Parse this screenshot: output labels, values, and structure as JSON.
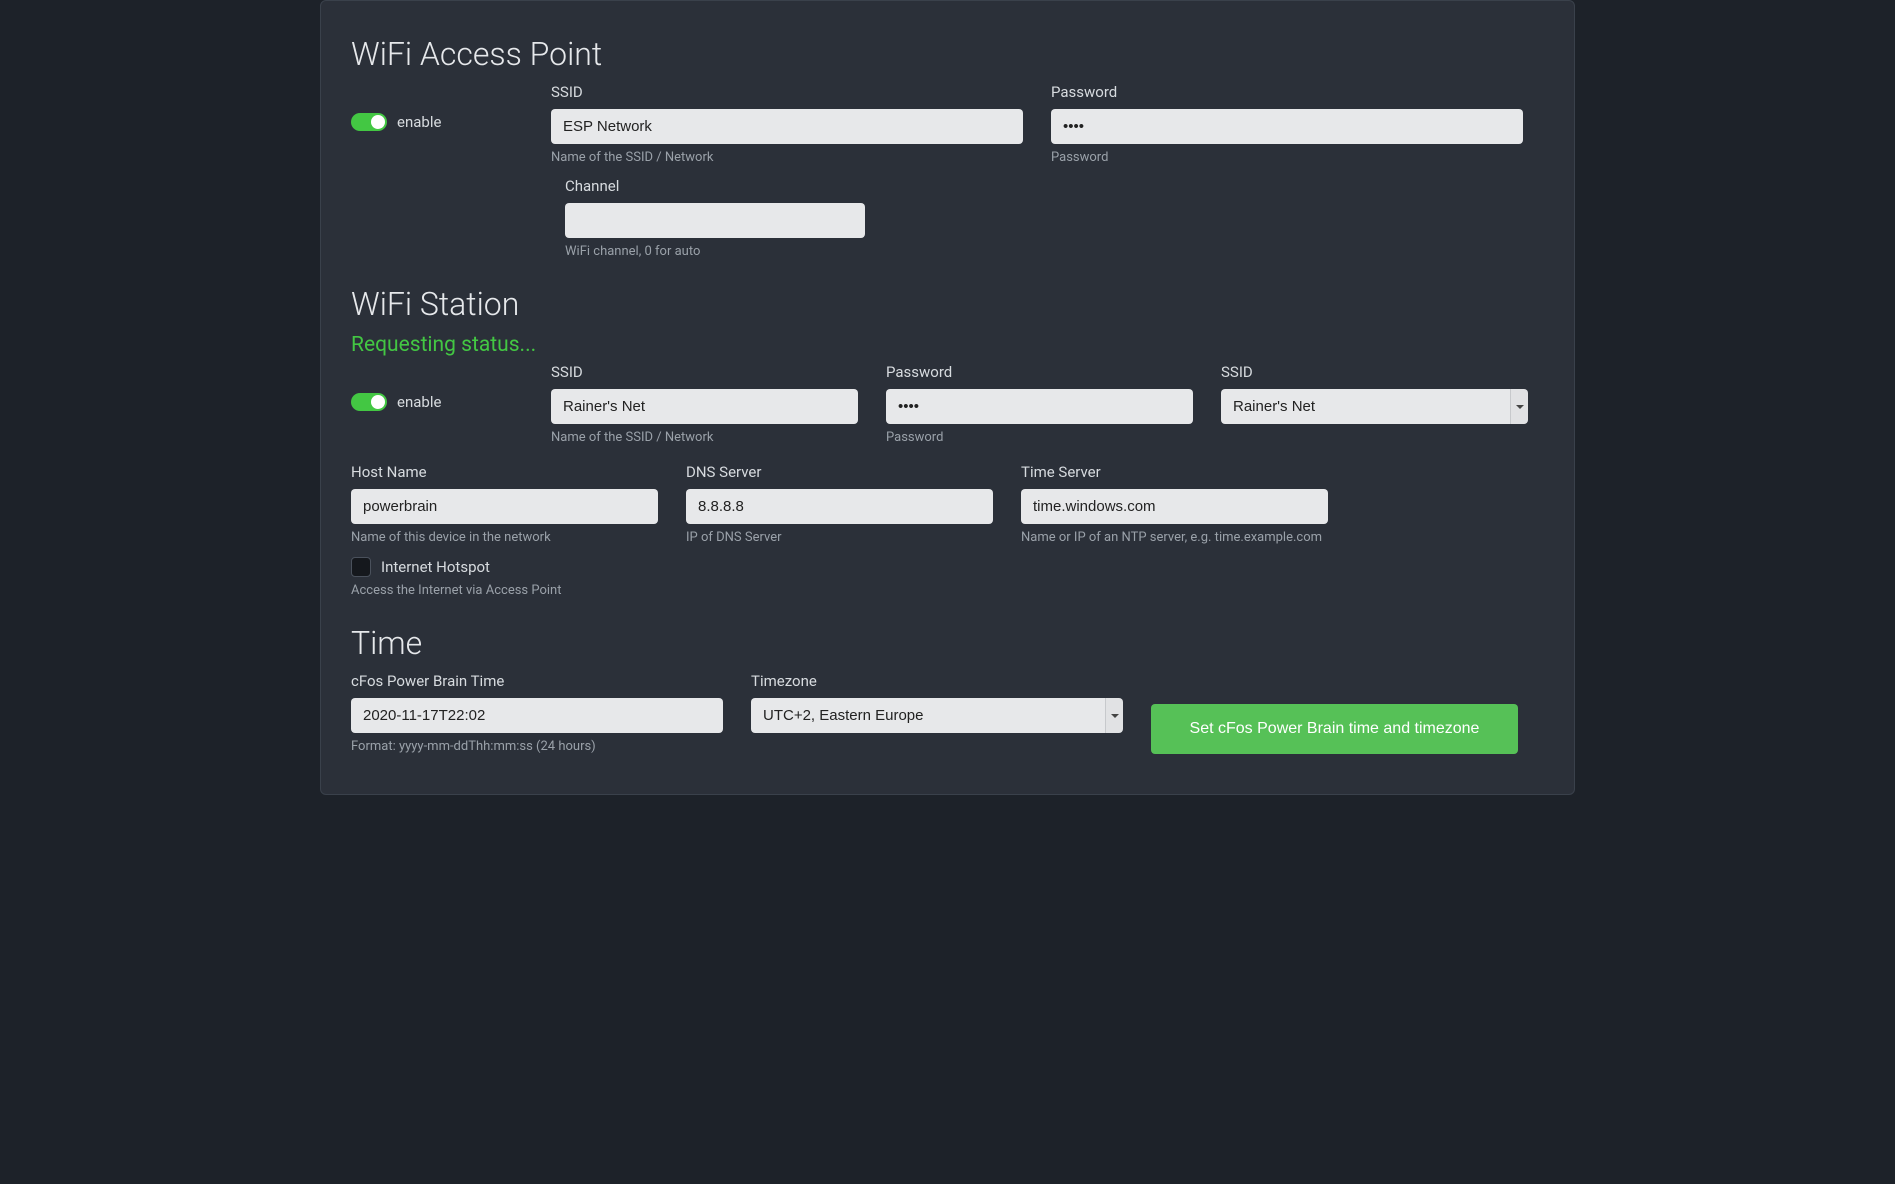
{
  "ap": {
    "title": "WiFi Access Point",
    "enable_label": "enable",
    "enable_on": true,
    "ssid_label": "SSID",
    "ssid_value": "ESP Network",
    "ssid_help": "Name of the SSID / Network",
    "password_label": "Password",
    "password_value": "pass",
    "password_help": "Password",
    "channel_label": "Channel",
    "channel_value": "",
    "channel_help": "WiFi channel, 0 for auto"
  },
  "station": {
    "title": "WiFi Station",
    "status": "Requesting status...",
    "enable_label": "enable",
    "enable_on": true,
    "ssid_label": "SSID",
    "ssid_value": "Rainer's Net",
    "ssid_help": "Name of the SSID / Network",
    "password_label": "Password",
    "password_value": "pass",
    "password_help": "Password",
    "ssid_select_label": "SSID",
    "ssid_select_value": "Rainer's Net",
    "hostname_label": "Host Name",
    "hostname_value": "powerbrain",
    "hostname_help": "Name of this device in the network",
    "dns_label": "DNS Server",
    "dns_value": "8.8.8.8",
    "dns_help": "IP of DNS Server",
    "timeserver_label": "Time Server",
    "timeserver_value": "time.windows.com",
    "timeserver_help": "Name or IP of an NTP server, e.g. time.example.com",
    "hotspot_label": "Internet Hotspot",
    "hotspot_help": "Access the Internet via Access Point",
    "hotspot_checked": false
  },
  "time": {
    "title": "Time",
    "device_time_label": "cFos Power Brain Time",
    "device_time_value": "2020-11-17T22:02",
    "device_time_help": "Format: yyyy-mm-ddThh:mm:ss (24 hours)",
    "tz_label": "Timezone",
    "tz_value": "UTC+2, Eastern Europe",
    "button_label": "Set cFos Power Brain time and timezone"
  }
}
